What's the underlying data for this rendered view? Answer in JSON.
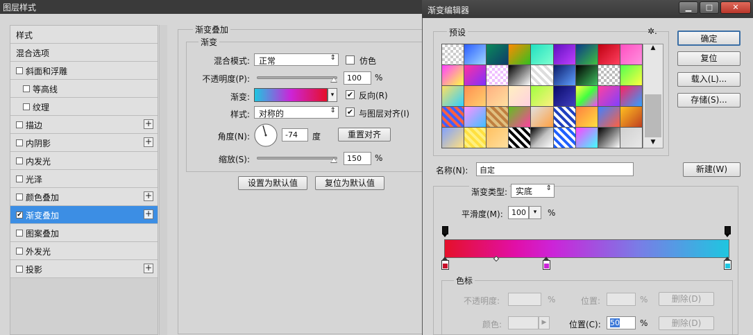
{
  "layer_style": {
    "title": "图层样式",
    "style_list": [
      {
        "label": "样式",
        "checkbox": false,
        "indent": false,
        "plus": false
      },
      {
        "label": "混合选项",
        "checkbox": false,
        "indent": false,
        "plus": false
      },
      {
        "label": "斜面和浮雕",
        "checkbox": true,
        "checked": false,
        "indent": false,
        "plus": false
      },
      {
        "label": "等高线",
        "checkbox": true,
        "checked": false,
        "indent": true,
        "plus": false
      },
      {
        "label": "纹理",
        "checkbox": true,
        "checked": false,
        "indent": true,
        "plus": false
      },
      {
        "label": "描边",
        "checkbox": true,
        "checked": false,
        "indent": false,
        "plus": true
      },
      {
        "label": "内阴影",
        "checkbox": true,
        "checked": false,
        "indent": false,
        "plus": true
      },
      {
        "label": "内发光",
        "checkbox": true,
        "checked": false,
        "indent": false,
        "plus": false
      },
      {
        "label": "光泽",
        "checkbox": true,
        "checked": false,
        "indent": false,
        "plus": false
      },
      {
        "label": "颜色叠加",
        "checkbox": true,
        "checked": false,
        "indent": false,
        "plus": true
      },
      {
        "label": "渐变叠加",
        "checkbox": true,
        "checked": true,
        "indent": false,
        "plus": true,
        "selected": true
      },
      {
        "label": "图案叠加",
        "checkbox": true,
        "checked": false,
        "indent": false,
        "plus": false
      },
      {
        "label": "外发光",
        "checkbox": true,
        "checked": false,
        "indent": false,
        "plus": false
      },
      {
        "label": "投影",
        "checkbox": true,
        "checked": false,
        "indent": false,
        "plus": true
      }
    ],
    "panel": {
      "group_title": "渐变叠加",
      "sub_group_title": "渐变",
      "blend_mode_label": "混合模式:",
      "blend_mode_value": "正常",
      "dither_label": "仿色",
      "opacity_label": "不透明度(P):",
      "opacity_value": "100",
      "opacity_unit": "%",
      "gradient_label": "渐变:",
      "reverse_label": "反向(R)",
      "style_label": "样式:",
      "style_value": "对称的",
      "align_label": "与图层对齐(I)",
      "angle_label": "角度(N):",
      "angle_value": "-74",
      "angle_unit": "度",
      "reset_align_label": "重置对齐",
      "scale_label": "缩放(S):",
      "scale_value": "150",
      "scale_unit": "%",
      "make_default_label": "设置为默认值",
      "reset_default_label": "复位为默认值"
    }
  },
  "gradient_editor": {
    "title": "渐变编辑器",
    "presets_label": "预设",
    "gear_label": "✲.",
    "ok_label": "确定",
    "reset_label": "复位",
    "load_label": "载入(L)...",
    "save_label": "存储(S)...",
    "name_label": "名称(N):",
    "name_value": "自定",
    "new_label": "新建(W)",
    "type_label": "渐变类型:",
    "type_value": "实底",
    "smooth_label": "平滑度(M):",
    "smooth_value": "100",
    "smooth_unit": "%",
    "stops_group": "色标",
    "stop_opacity_label": "不透明度:",
    "stop_opacity_unit": "%",
    "stop_location_label": "位置:",
    "stop_location_unit": "%",
    "delete_label": "删除(D)",
    "color_label": "颜色:",
    "color_location_label": "位置(C):",
    "color_location_value": "50",
    "color_location_unit": "%",
    "delete2_label": "删除(D)"
  },
  "icons": [
    "minimize-icon",
    "maximize-icon",
    "close-icon",
    "gear-icon",
    "angle-dial-icon"
  ]
}
